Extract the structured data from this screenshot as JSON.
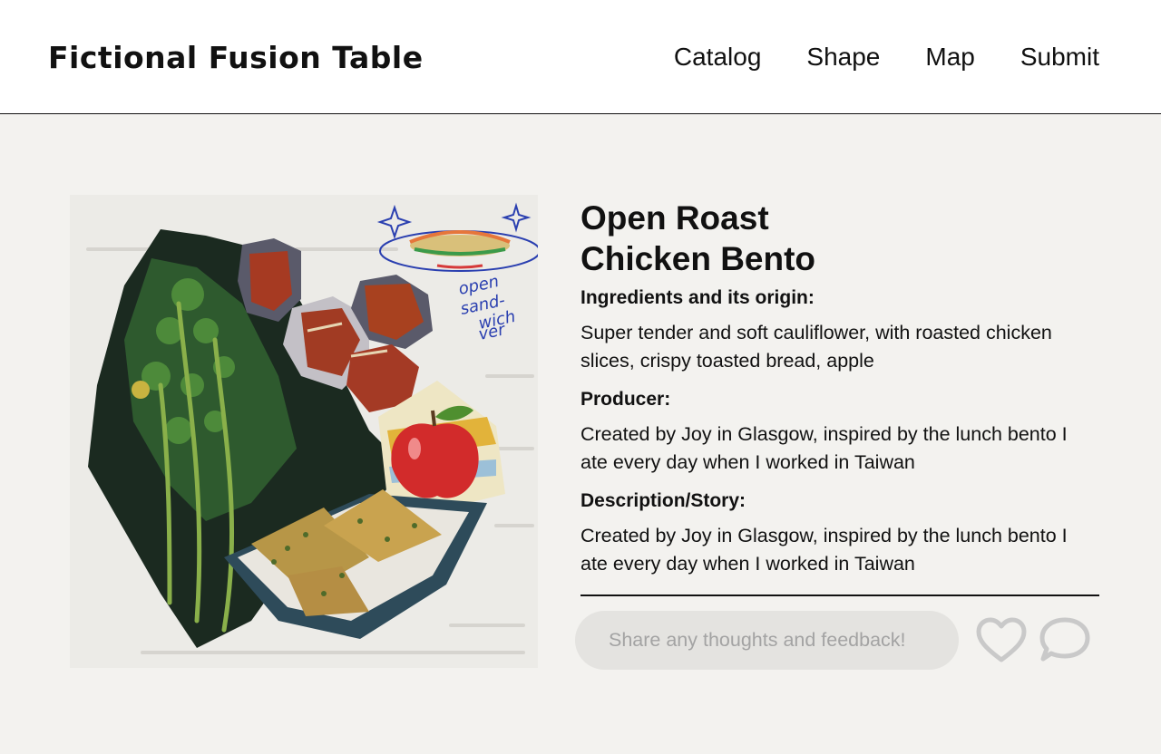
{
  "header": {
    "brand": "Fictional Fusion Table",
    "nav": [
      "Catalog",
      "Shape",
      "Map",
      "Submit"
    ]
  },
  "artwork": {
    "handwriting": [
      "open",
      "sand-",
      "wich",
      "ver"
    ]
  },
  "dish": {
    "title_line1": "Open Roast",
    "title_line2": "Chicken Bento",
    "ingredients_label": "Ingredients and its origin:",
    "ingredients": "Super tender and soft cauliflower, with roasted chicken slices, crispy toasted bread, apple",
    "producer_label": "Producer:",
    "producer": "Created by Joy in Glasgow, inspired by the lunch bento I ate every day when I worked in Taiwan",
    "story_label": "Description/Story:",
    "story": "Created by Joy in Glasgow, inspired by the lunch bento I ate every day when I worked in Taiwan"
  },
  "feedback": {
    "placeholder": "Share any thoughts and feedback!"
  },
  "icons": {
    "like": "heart-icon",
    "comment": "speech-bubble-icon"
  },
  "colors": {
    "background": "#f3f2ef",
    "header_bg": "#ffffff",
    "input_bg": "#e4e3e0",
    "icon_gray": "#c9c9c9"
  }
}
